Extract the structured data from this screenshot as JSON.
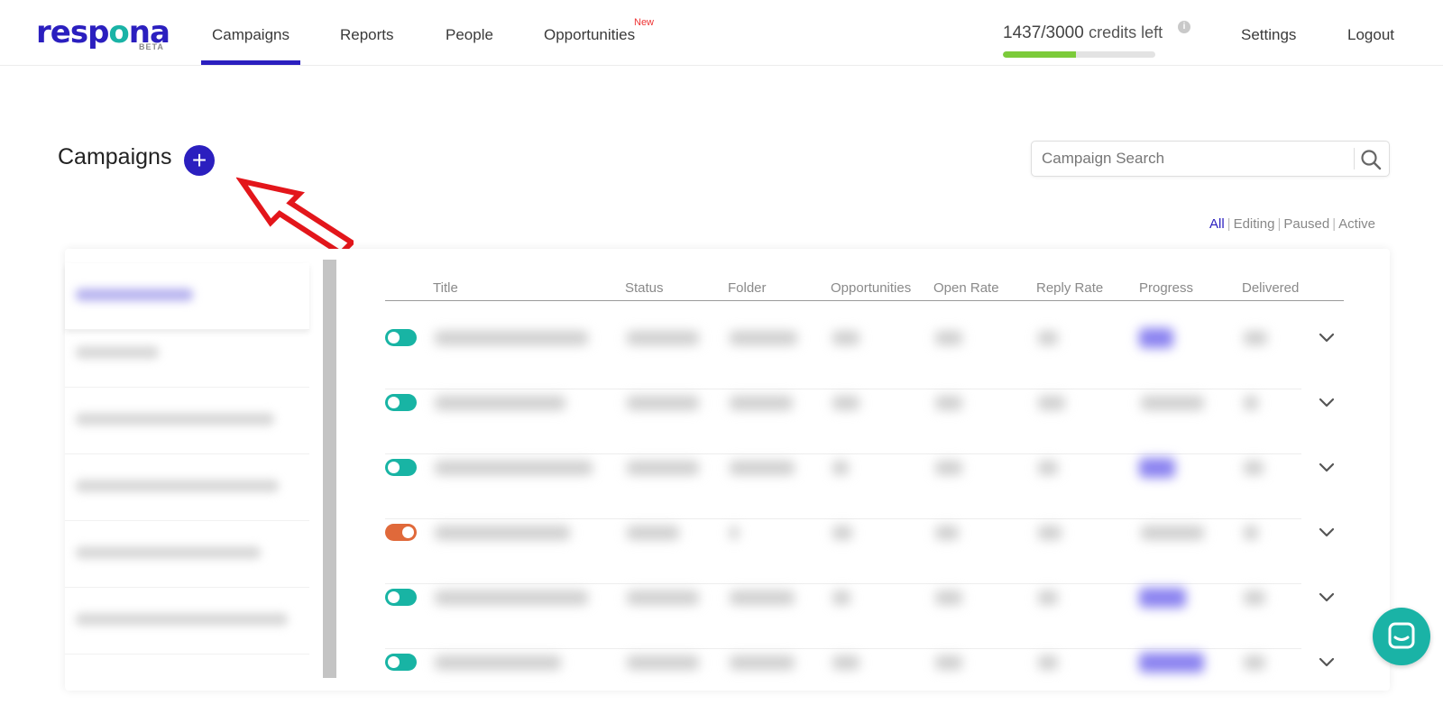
{
  "brand": {
    "name_part1": "resp",
    "name_o": "o",
    "name_part2": "na",
    "beta": "BETA"
  },
  "nav": {
    "items": [
      {
        "label": "Campaigns",
        "active": true
      },
      {
        "label": "Reports"
      },
      {
        "label": "People"
      },
      {
        "label": "Opportunities",
        "badge": "New"
      }
    ],
    "settings": "Settings",
    "logout": "Logout"
  },
  "credits": {
    "used": "1437/3000",
    "suffix": "credits left",
    "fraction_remaining": 0.479,
    "info_icon": "i"
  },
  "page": {
    "title": "Campaigns",
    "add_icon": "+"
  },
  "search": {
    "placeholder": "Campaign Search"
  },
  "filters": [
    "All",
    "Editing",
    "Paused",
    "Active"
  ],
  "table": {
    "headers": [
      "Title",
      "Status",
      "Folder",
      "Opportunities",
      "Open Rate",
      "Reply Rate",
      "Progress",
      "Delivered"
    ],
    "rows": [
      {
        "toggle": "on"
      },
      {
        "toggle": "on"
      },
      {
        "toggle": "on"
      },
      {
        "toggle": "paused"
      },
      {
        "toggle": "on"
      },
      {
        "toggle": "on"
      }
    ]
  },
  "colors": {
    "brand": "#2b1fbf",
    "teal": "#18b4a4",
    "orange": "#e0693a",
    "credit_green": "#7ccb3a",
    "annotation_red": "#e3161b"
  },
  "icons": {
    "search": "search-icon",
    "chevron": "chevron-down-icon",
    "chat": "chat-icon",
    "info": "info-icon",
    "add": "plus-icon"
  }
}
